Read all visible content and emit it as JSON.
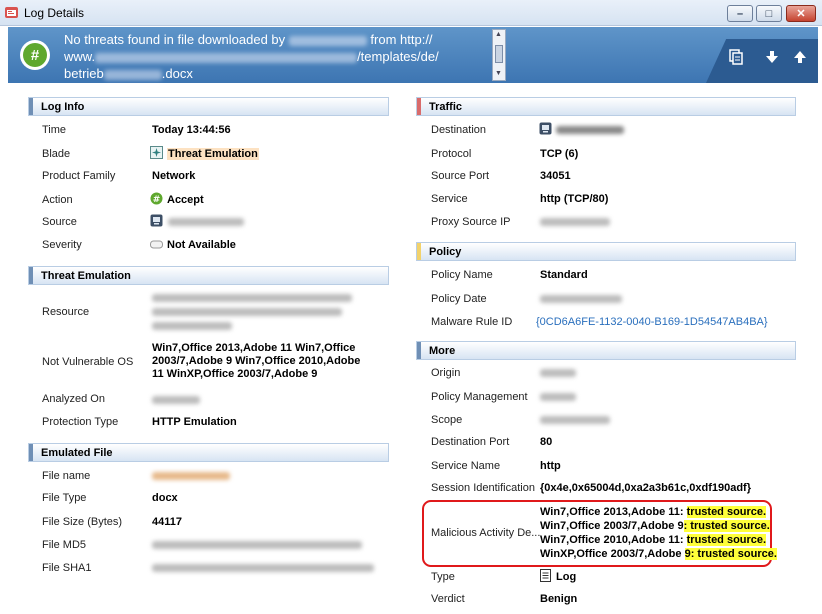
{
  "window": {
    "title": "Log Details",
    "minimize": "–",
    "maximize": "□",
    "close": "✕"
  },
  "banner": {
    "line1": "No threats found in file downloaded by",
    "line1_suffix": "from http://",
    "line2_prefix": "www.",
    "line2_suffix": "/templates/de/",
    "line3": "betrieb",
    "line3_suffix": ".docx"
  },
  "log_info": {
    "heading": "Log Info",
    "time_label": "Time",
    "time_value": "Today 13:44:56",
    "blade_label": "Blade",
    "blade_value": "Threat Emulation",
    "family_label": "Product Family",
    "family_value": "Network",
    "action_label": "Action",
    "action_value": "Accept",
    "source_label": "Source",
    "severity_label": "Severity",
    "severity_value": "Not Available"
  },
  "threat_emulation": {
    "heading": "Threat Emulation",
    "resource_label": "Resource",
    "not_vulnerable_label": "Not Vulnerable OS",
    "not_vulnerable_value": "Win7,Office 2013,Adobe 11 Win7,Office 2003/7,Adobe 9 Win7,Office 2010,Adobe 11 WinXP,Office 2003/7,Adobe 9",
    "analyzed_label": "Analyzed On",
    "protection_label": "Protection Type",
    "protection_value": "HTTP Emulation"
  },
  "emulated_file": {
    "heading": "Emulated File",
    "name_label": "File name",
    "type_label": "File Type",
    "type_value": "docx",
    "size_label": "File Size (Bytes)",
    "size_value": "44117",
    "md5_label": "File MD5",
    "sha1_label": "File SHA1"
  },
  "traffic": {
    "heading": "Traffic",
    "dest_label": "Destination",
    "protocol_label": "Protocol",
    "protocol_value": "TCP (6)",
    "sport_label": "Source Port",
    "sport_value": "34051",
    "service_label": "Service",
    "service_value": "http (TCP/80)",
    "proxy_label": "Proxy Source IP"
  },
  "policy": {
    "heading": "Policy",
    "name_label": "Policy Name",
    "name_value": "Standard",
    "date_label": "Policy Date",
    "rule_label": "Malware Rule ID",
    "rule_value": "{0CD6A6FE-1132-0040-B169-1D54547AB4BA}"
  },
  "more": {
    "heading": "More",
    "origin_label": "Origin",
    "mgmt_label": "Policy Management",
    "scope_label": "Scope",
    "dport_label": "Destination Port",
    "dport_value": "80",
    "svc_label": "Service Name",
    "svc_value": "http",
    "session_label": "Session Identification",
    "session_value": "{0x4e,0x65004d,0xa2a3b61c,0xdf190adf}",
    "malicious_label": "Malicious Activity De...",
    "malicious_lines": [
      {
        "pre": "Win7,Office 2013,Adobe 11: ",
        "hl": "trusted source."
      },
      {
        "pre": "Win7,Office 2003/7,Adobe 9",
        "hl": ": trusted source."
      },
      {
        "pre": "Win7,Office 2010,Adobe 11: ",
        "hl": "trusted source."
      },
      {
        "pre": "WinXP,Office 2003/7,Adobe ",
        "hl": "9: trusted source."
      }
    ],
    "type_label": "Type",
    "type_value": "Log",
    "verdict_label": "Verdict",
    "verdict_value": "Benign"
  },
  "colors": {
    "banner": "#4a82be",
    "highlight": "#ffff3a",
    "red_outline": "#e0191b",
    "link": "#2a6fbd"
  }
}
